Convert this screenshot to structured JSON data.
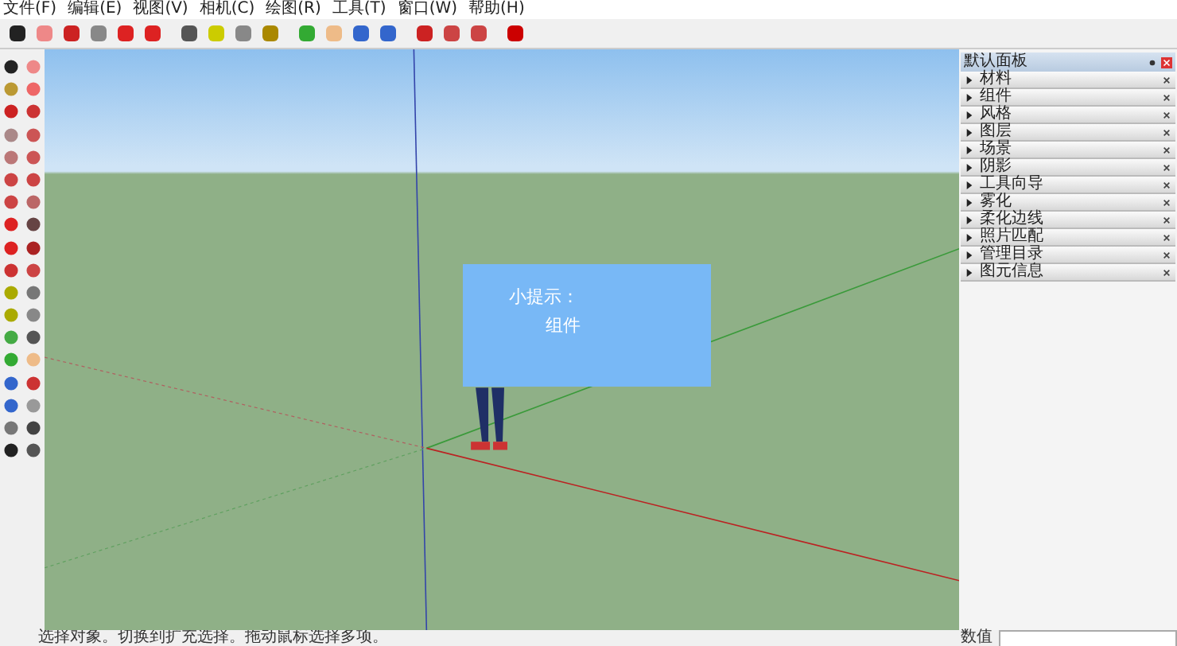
{
  "menu": [
    "文件(F)",
    "编辑(E)",
    "视图(V)",
    "相机(C)",
    "绘图(R)",
    "工具(T)",
    "窗口(W)",
    "帮助(H)"
  ],
  "tip": {
    "title": "小提示：",
    "text": "组件"
  },
  "panel": {
    "title": "默认面板",
    "items": [
      {
        "label": "材料",
        "expanded": false
      },
      {
        "label": "组件",
        "expanded": false
      },
      {
        "label": "风格",
        "expanded": false
      },
      {
        "label": "图层",
        "expanded": false
      },
      {
        "label": "场景",
        "expanded": false
      },
      {
        "label": "阴影",
        "expanded": false
      },
      {
        "label": "工具向导",
        "expanded": false
      },
      {
        "label": "雾化",
        "expanded": false
      },
      {
        "label": "柔化边线",
        "expanded": false
      },
      {
        "label": "照片匹配",
        "expanded": false
      },
      {
        "label": "管理目录",
        "expanded": false
      },
      {
        "label": "图元信息",
        "expanded": false
      }
    ]
  },
  "status_bar": {
    "text": "选择对象。切换到扩充选择。拖动鼠标选择多项。",
    "measure_label": "数值"
  }
}
